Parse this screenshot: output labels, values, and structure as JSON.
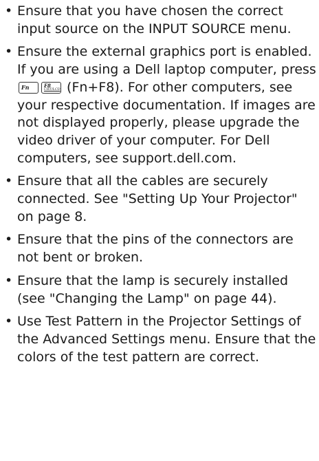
{
  "items": [
    {
      "text": "Ensure that you have chosen the correct input source on the INPUT SOURCE menu."
    },
    {
      "text_before": "Ensure the external graphics port is enabled. If you are using a Dell laptop computer, press",
      "key_fn": "Fn",
      "key_f8": "F8",
      "key_f8_sub": "CRT/LCD",
      "text_after": "(Fn+F8). For other computers, see your respective documentation. If images are not displayed properly, please upgrade the video driver of your computer. For Dell computers, see support.dell.com."
    },
    {
      "text": "Ensure that all the cables are securely connected. See \"Setting Up Your Projector\" on page 8."
    },
    {
      "text": "Ensure that the pins of the connectors are not bent or broken."
    },
    {
      "text": "Ensure that the lamp is securely installed (see \"Changing the Lamp\" on page 44)."
    },
    {
      "text": "Use Test Pattern in the Projector Settings of the Advanced Settings menu. Ensure that the colors of the test pattern are correct."
    }
  ],
  "bullet_glyph": "•"
}
